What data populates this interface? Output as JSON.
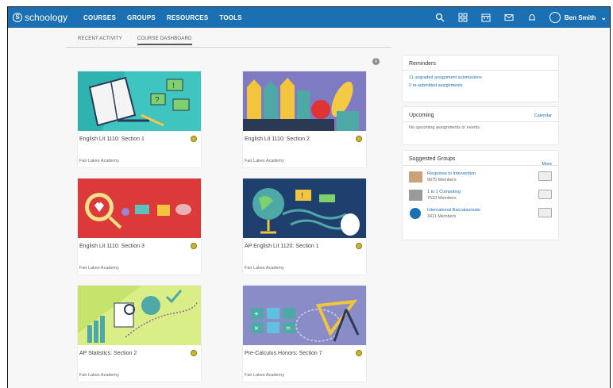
{
  "header": {
    "brand": "schoology",
    "nav": [
      "COURSES",
      "GROUPS",
      "RESOURCES",
      "TOOLS"
    ],
    "user_name": "Ben Smith",
    "icons": [
      "search-icon",
      "apps-grid-icon",
      "calendar-icon",
      "messages-icon",
      "notifications-icon"
    ],
    "colors": {
      "bar": "#1b6fb3"
    }
  },
  "tabs": {
    "recent": "RECENT ACTIVITY",
    "dashboard": "COURSE DASHBOARD"
  },
  "courses": [
    {
      "title": "English Lit 1110: Section 1",
      "school": "Fair Lakes Academy"
    },
    {
      "title": "English Lit 1110: Section 2",
      "school": "Fair Lakes Academy"
    },
    {
      "title": "English Lit 1110: Section 3",
      "school": "Fair Lakes Academy"
    },
    {
      "title": "AP English Lit 1120: Section 1",
      "school": "Fair Lakes Academy"
    },
    {
      "title": "AP Statistics: Section 2",
      "school": "Fair Lakes Academy"
    },
    {
      "title": "Pre-Calculus Honors: Section 7",
      "school": "Fair Lakes Academy"
    }
  ],
  "reminders": {
    "title": "Reminders",
    "items": [
      "11 ungraded assignment submissions",
      "2 re-submitted assignments"
    ]
  },
  "upcoming": {
    "title": "Upcoming",
    "calendar_link": "Calendar",
    "empty": "No upcoming assignments or events"
  },
  "suggested": {
    "title": "Suggested Groups",
    "more": "More",
    "groups": [
      {
        "name": "Response to Intervention",
        "members": "9075 Members"
      },
      {
        "name": "1 to 1 Computing",
        "members": "7533 Members"
      },
      {
        "name": "International Baccalaureate",
        "members": "3411 Members"
      }
    ]
  }
}
